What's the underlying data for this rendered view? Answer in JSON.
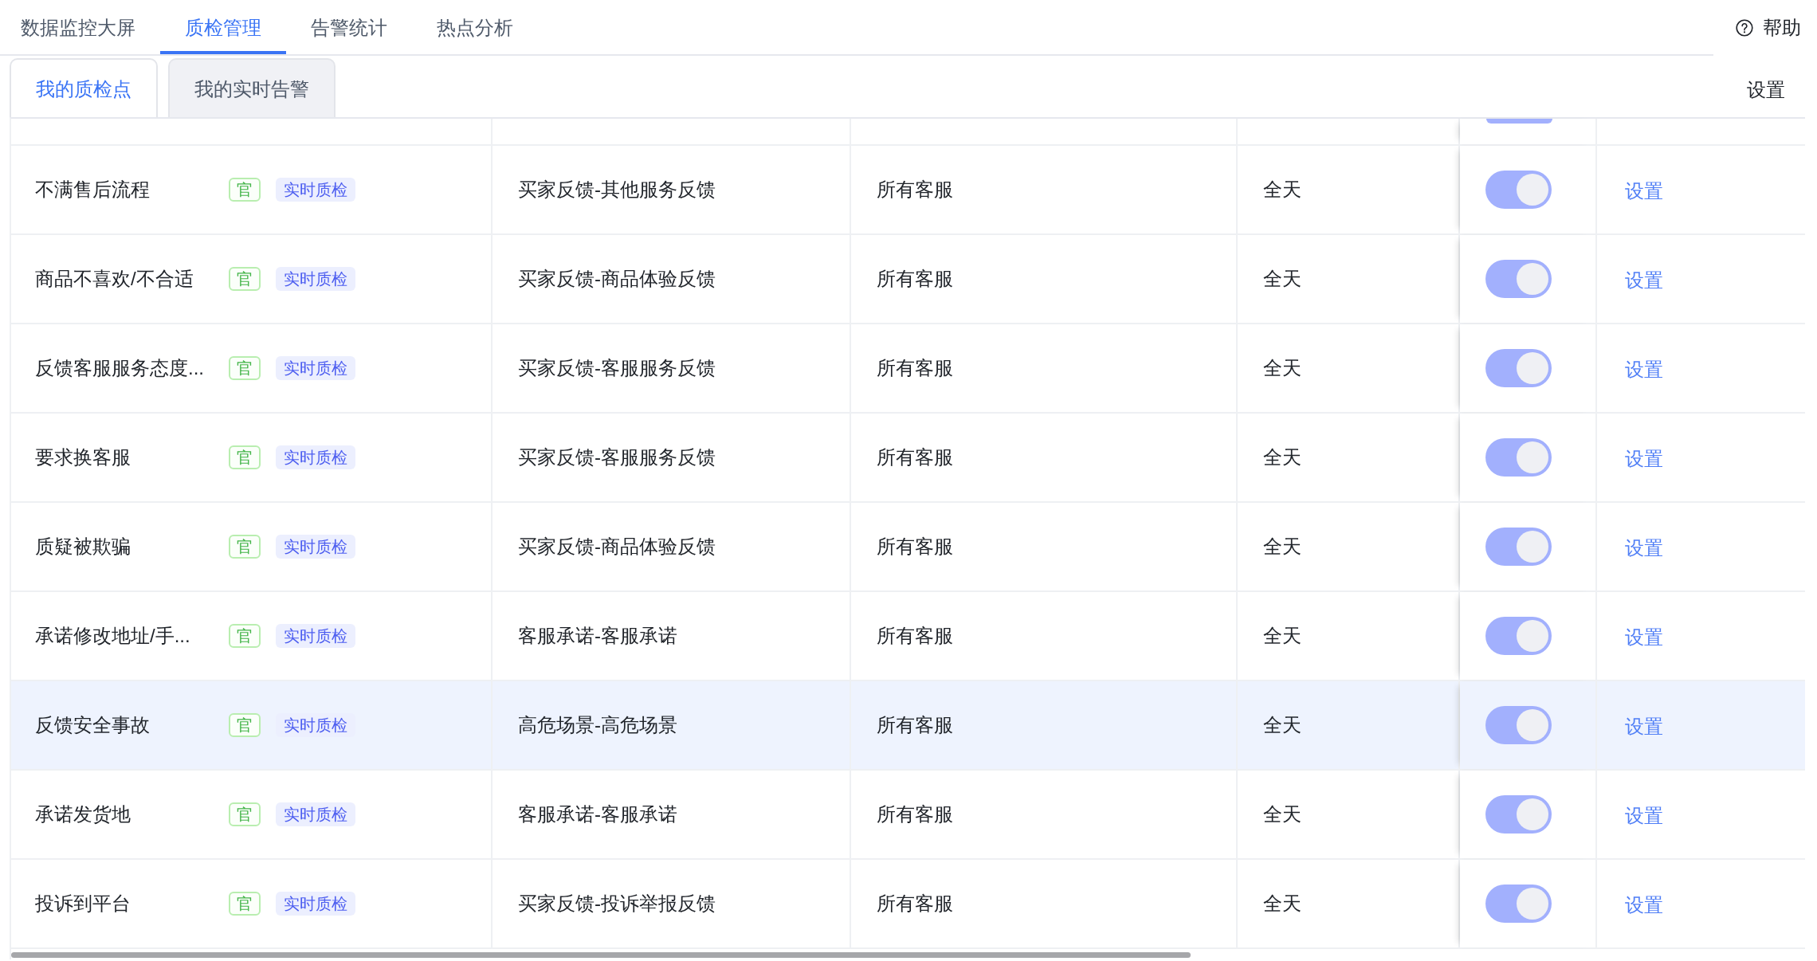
{
  "top_nav": {
    "tabs": [
      {
        "label": "数据监控大屏",
        "selected": false
      },
      {
        "label": "质检管理",
        "selected": true
      },
      {
        "label": "告警统计",
        "selected": false
      },
      {
        "label": "热点分析",
        "selected": false
      }
    ],
    "help": "帮助"
  },
  "sub_tabs": [
    {
      "label": "我的质检点",
      "selected": true
    },
    {
      "label": "我的实时告警",
      "selected": false
    }
  ],
  "settings": "设置",
  "table": {
    "partial_top_row": {
      "on": true
    },
    "rows": [
      {
        "name": "不满售后流程",
        "tags": [
          {
            "kind": "official",
            "text": "官"
          },
          {
            "kind": "mode",
            "text": "实时质检"
          }
        ],
        "category": "买家反馈-其他服务反馈",
        "scope": "所有客服",
        "time": "全天",
        "on": true,
        "selected": false,
        "action": "设置"
      },
      {
        "name": "商品不喜欢/不合适",
        "tags": [
          {
            "kind": "official",
            "text": "官"
          },
          {
            "kind": "mode",
            "text": "实时质检"
          }
        ],
        "category": "买家反馈-商品体验反馈",
        "scope": "所有客服",
        "time": "全天",
        "on": true,
        "selected": false,
        "action": "设置"
      },
      {
        "name": "反馈客服服务态度...",
        "tags": [
          {
            "kind": "official",
            "text": "官"
          },
          {
            "kind": "mode",
            "text": "实时质检"
          }
        ],
        "category": "买家反馈-客服服务反馈",
        "scope": "所有客服",
        "time": "全天",
        "on": true,
        "selected": false,
        "action": "设置"
      },
      {
        "name": "要求换客服",
        "tags": [
          {
            "kind": "official",
            "text": "官"
          },
          {
            "kind": "mode",
            "text": "实时质检"
          }
        ],
        "category": "买家反馈-客服服务反馈",
        "scope": "所有客服",
        "time": "全天",
        "on": true,
        "selected": false,
        "action": "设置"
      },
      {
        "name": "质疑被欺骗",
        "tags": [
          {
            "kind": "official",
            "text": "官"
          },
          {
            "kind": "mode",
            "text": "实时质检"
          }
        ],
        "category": "买家反馈-商品体验反馈",
        "scope": "所有客服",
        "time": "全天",
        "on": true,
        "selected": false,
        "action": "设置"
      },
      {
        "name": "承诺修改地址/手...",
        "tags": [
          {
            "kind": "official",
            "text": "官"
          },
          {
            "kind": "mode",
            "text": "实时质检"
          }
        ],
        "category": "客服承诺-客服承诺",
        "scope": "所有客服",
        "time": "全天",
        "on": true,
        "selected": false,
        "action": "设置"
      },
      {
        "name": "反馈安全事故",
        "tags": [
          {
            "kind": "official",
            "text": "官"
          },
          {
            "kind": "mode",
            "text": "实时质检"
          }
        ],
        "category": "高危场景-高危场景",
        "scope": "所有客服",
        "time": "全天",
        "on": true,
        "selected": true,
        "action": "设置"
      },
      {
        "name": "承诺发货地",
        "tags": [
          {
            "kind": "official",
            "text": "官"
          },
          {
            "kind": "mode",
            "text": "实时质检"
          }
        ],
        "category": "客服承诺-客服承诺",
        "scope": "所有客服",
        "time": "全天",
        "on": true,
        "selected": false,
        "action": "设置"
      },
      {
        "name": "投诉到平台",
        "tags": [
          {
            "kind": "official",
            "text": "官"
          },
          {
            "kind": "mode",
            "text": "实时质检"
          }
        ],
        "category": "买家反馈-投诉举报反馈",
        "scope": "所有客服",
        "time": "全天",
        "on": true,
        "selected": false,
        "action": "设置"
      }
    ]
  }
}
